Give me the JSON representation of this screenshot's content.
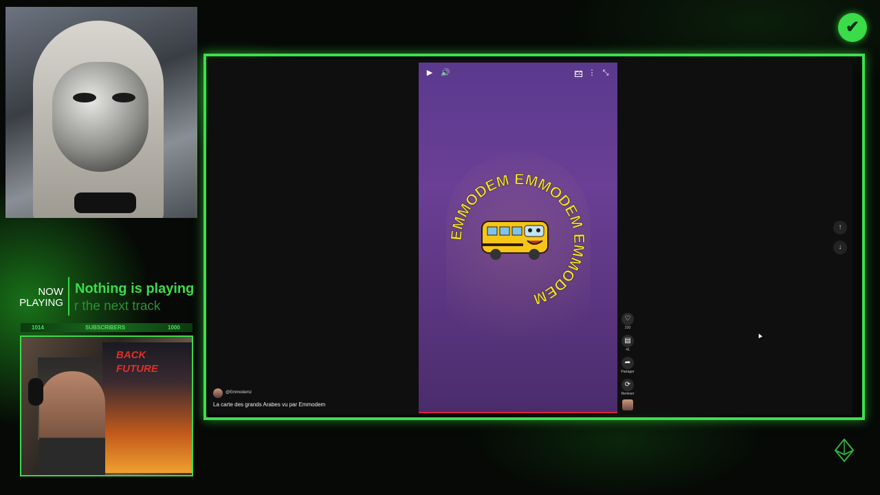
{
  "stream": {
    "now_playing_label_1": "NOW",
    "now_playing_label_2": "PLAYING",
    "track_title": "Nothing is playing",
    "track_subtitle": "Waiting for the next track",
    "subscribers": {
      "current": "1014",
      "label": "SUBSCRIBERS",
      "goal": "1000"
    },
    "badge_icon": "check-icon",
    "poster_text_1": "BACK",
    "poster_text_2": "FUTURE"
  },
  "player": {
    "controls": {
      "play_icon": "▶",
      "volume_icon": "🔊",
      "captions_icon": "CC",
      "more_icon": "⋮",
      "collapse_icon": "⤡"
    },
    "logo_ring_text": "EMMODEM EMMODEM EMMODEM",
    "actions": [
      {
        "icon": "heart-icon",
        "glyph": "♡",
        "count": "210"
      },
      {
        "icon": "comment-icon",
        "glyph": "▤",
        "count": "41"
      },
      {
        "icon": "share-icon",
        "glyph": "➦",
        "count": "Partager"
      },
      {
        "icon": "remix-icon",
        "glyph": "⟳",
        "count": "Remixer"
      }
    ],
    "channel": "@Emmodemz",
    "title": "La carte des grands Arabes vu par Emmodem",
    "nav_up": "↑",
    "nav_down": "↓"
  },
  "colors": {
    "accent": "#3ddf4c",
    "video_bg": "#5a3a8e",
    "logo_text": "#f5e02a"
  }
}
